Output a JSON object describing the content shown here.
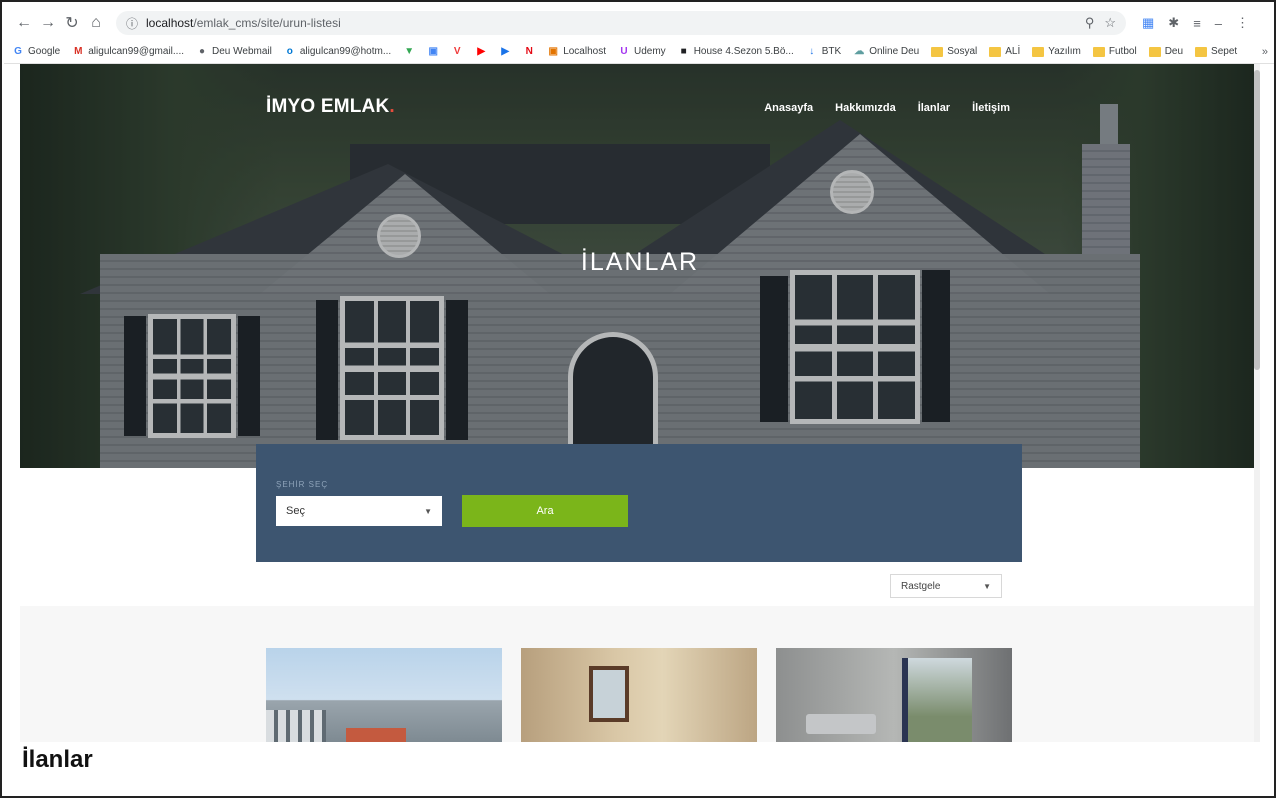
{
  "browser": {
    "url_host": "localhost",
    "url_path": "/emlak_cms/site/urun-listesi",
    "bookmarks": [
      {
        "label": "Google",
        "icon": "google-icon",
        "color": "#4285f4"
      },
      {
        "label": "aligulcan99@gmail....",
        "icon": "gmail-icon",
        "color": "#d93025"
      },
      {
        "label": "Deu Webmail",
        "icon": "globe-icon",
        "color": "#5f6368"
      },
      {
        "label": "aligulcan99@hotm...",
        "icon": "outlook-icon",
        "color": "#0078d4"
      },
      {
        "label": "",
        "icon": "maps-icon",
        "color": "#34a853"
      },
      {
        "label": "",
        "icon": "translate-icon",
        "color": "#4285f4"
      },
      {
        "label": "",
        "icon": "vivaldi-icon",
        "color": "#ef3939"
      },
      {
        "label": "",
        "icon": "youtube-icon",
        "color": "#ff0000"
      },
      {
        "label": "",
        "icon": "play-icon",
        "color": "#1a73e8"
      },
      {
        "label": "",
        "icon": "netflix-icon",
        "color": "#e50914"
      },
      {
        "label": "Localhost",
        "icon": "localhost-icon",
        "color": "#e37400"
      },
      {
        "label": "Udemy",
        "icon": "udemy-icon",
        "color": "#a435f0"
      },
      {
        "label": "House 4.Sezon 5.Bö...",
        "icon": "tv-icon",
        "color": "#202124"
      },
      {
        "label": "BTK",
        "icon": "btk-icon",
        "color": "#1a73e8"
      },
      {
        "label": "Online Deu",
        "icon": "cloud-icon",
        "color": "#5f9ea0"
      },
      {
        "label": "Sosyal",
        "icon": "folder-icon",
        "color": "#f4c542"
      },
      {
        "label": "ALİ",
        "icon": "folder-icon",
        "color": "#f4c542"
      },
      {
        "label": "Yazılım",
        "icon": "folder-icon",
        "color": "#f4c542"
      },
      {
        "label": "Futbol",
        "icon": "folder-icon",
        "color": "#f4c542"
      },
      {
        "label": "Deu",
        "icon": "folder-icon",
        "color": "#f4c542"
      },
      {
        "label": "Sepet",
        "icon": "folder-icon",
        "color": "#f4c542"
      }
    ],
    "more": "»"
  },
  "site": {
    "logo_text": "İMYO EMLAK",
    "logo_dot": ".",
    "menu": [
      "Anasayfa",
      "Hakkımızda",
      "İlanlar",
      "İletişim"
    ],
    "hero_title": "İLANLAR",
    "search": {
      "label": "ŞEHİR SEÇ",
      "select_value": "Seç",
      "button_label": "Ara"
    },
    "sort_value": "Rastgele",
    "accent": "#7bb51a",
    "panel_color": "#3d5570"
  },
  "caption": "İlanlar"
}
